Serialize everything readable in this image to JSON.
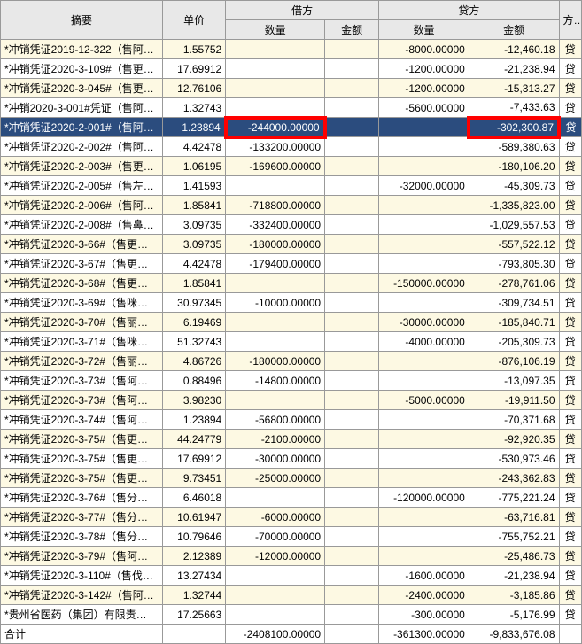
{
  "headers": {
    "summary": "摘要",
    "unitPrice": "单价",
    "debit": "借方",
    "credit": "贷方",
    "qty": "数量",
    "amount": "金额",
    "direction": "方向"
  },
  "footerLabel": "合计",
  "footer": {
    "dqty": "-2408100.00000",
    "damt": "",
    "cqty": "-361300.00000",
    "camt": "-9,833,676.08",
    "dir": ""
  },
  "rows": [
    {
      "summary": "*冲销凭证2019-12-322（售阿…",
      "price": "1.55752",
      "dqty": "",
      "damt": "",
      "cqty": "-8000.00000",
      "camt": "-12,460.18",
      "dir": "贷"
    },
    {
      "summary": "*冲销凭证2020-3-109#（售更…",
      "price": "17.69912",
      "dqty": "",
      "damt": "",
      "cqty": "-1200.00000",
      "camt": "-21,238.94",
      "dir": "贷"
    },
    {
      "summary": "*冲销凭证2020-3-045#（售更…",
      "price": "12.76106",
      "dqty": "",
      "damt": "",
      "cqty": "-1200.00000",
      "camt": "-15,313.27",
      "dir": "贷"
    },
    {
      "summary": "*冲销2020-3-001#凭证（售阿…",
      "price": "1.32743",
      "dqty": "",
      "damt": "",
      "cqty": "-5600.00000",
      "camt": "-7,433.63",
      "dir": "贷"
    },
    {
      "summary": "*冲销凭证2020-2-001#（售阿…",
      "price": "1.23894",
      "dqty": "-244000.00000",
      "damt": "",
      "cqty": "",
      "camt": "-302,300.87",
      "dir": "贷",
      "selected": true,
      "hl_dqty": true,
      "hl_camt": true
    },
    {
      "summary": "*冲销凭证2020-2-002#（售阿…",
      "price": "4.42478",
      "dqty": "-133200.00000",
      "damt": "",
      "cqty": "",
      "camt": "-589,380.63",
      "dir": "贷"
    },
    {
      "summary": "*冲销凭证2020-2-003#（售更…",
      "price": "1.06195",
      "dqty": "-169600.00000",
      "damt": "",
      "cqty": "",
      "camt": "-180,106.20",
      "dir": "贷"
    },
    {
      "summary": "*冲销凭证2020-2-005#（售左…",
      "price": "1.41593",
      "dqty": "",
      "damt": "",
      "cqty": "-32000.00000",
      "camt": "-45,309.73",
      "dir": "贷"
    },
    {
      "summary": "*冲销凭证2020-2-006#（售阿…",
      "price": "1.85841",
      "dqty": "-718800.00000",
      "damt": "",
      "cqty": "",
      "camt": "-1,335,823.00",
      "dir": "贷"
    },
    {
      "summary": "*冲销凭证2020-2-008#（售鼻…",
      "price": "3.09735",
      "dqty": "-332400.00000",
      "damt": "",
      "cqty": "",
      "camt": "-1,029,557.53",
      "dir": "贷"
    },
    {
      "summary": "*冲销凭证2020-3-66#（售更…",
      "price": "3.09735",
      "dqty": "-180000.00000",
      "damt": "",
      "cqty": "",
      "camt": "-557,522.12",
      "dir": "贷"
    },
    {
      "summary": "*冲销凭证2020-3-67#（售更…",
      "price": "4.42478",
      "dqty": "-179400.00000",
      "damt": "",
      "cqty": "",
      "camt": "-793,805.30",
      "dir": "贷"
    },
    {
      "summary": "*冲销凭证2020-3-68#（售更…",
      "price": "1.85841",
      "dqty": "",
      "damt": "",
      "cqty": "-150000.00000",
      "camt": "-278,761.06",
      "dir": "贷"
    },
    {
      "summary": "*冲销凭证2020-3-69#（售咪…",
      "price": "30.97345",
      "dqty": "-10000.00000",
      "damt": "",
      "cqty": "",
      "camt": "-309,734.51",
      "dir": "贷"
    },
    {
      "summary": "*冲销凭证2020-3-70#（售丽…",
      "price": "6.19469",
      "dqty": "",
      "damt": "",
      "cqty": "-30000.00000",
      "camt": "-185,840.71",
      "dir": "贷"
    },
    {
      "summary": "*冲销凭证2020-3-71#（售咪…",
      "price": "51.32743",
      "dqty": "",
      "damt": "",
      "cqty": "-4000.00000",
      "camt": "-205,309.73",
      "dir": "贷"
    },
    {
      "summary": "*冲销凭证2020-3-72#（售丽…",
      "price": "4.86726",
      "dqty": "-180000.00000",
      "damt": "",
      "cqty": "",
      "camt": "-876,106.19",
      "dir": "贷"
    },
    {
      "summary": "*冲销凭证2020-3-73#（售阿…",
      "price": "0.88496",
      "dqty": "-14800.00000",
      "damt": "",
      "cqty": "",
      "camt": "-13,097.35",
      "dir": "贷"
    },
    {
      "summary": "*冲销凭证2020-3-73#（售阿…",
      "price": "3.98230",
      "dqty": "",
      "damt": "",
      "cqty": "-5000.00000",
      "camt": "-19,911.50",
      "dir": "贷"
    },
    {
      "summary": "*冲销凭证2020-3-74#（售阿…",
      "price": "1.23894",
      "dqty": "-56800.00000",
      "damt": "",
      "cqty": "",
      "camt": "-70,371.68",
      "dir": "贷"
    },
    {
      "summary": "*冲销凭证2020-3-75#（售更…",
      "price": "44.24779",
      "dqty": "-2100.00000",
      "damt": "",
      "cqty": "",
      "camt": "-92,920.35",
      "dir": "贷"
    },
    {
      "summary": "*冲销凭证2020-3-75#（售更…",
      "price": "17.69912",
      "dqty": "-30000.00000",
      "damt": "",
      "cqty": "",
      "camt": "-530,973.46",
      "dir": "贷"
    },
    {
      "summary": "*冲销凭证2020-3-75#（售更…",
      "price": "9.73451",
      "dqty": "-25000.00000",
      "damt": "",
      "cqty": "",
      "camt": "-243,362.83",
      "dir": "贷"
    },
    {
      "summary": "*冲销凭证2020-3-76#（售分…",
      "price": "6.46018",
      "dqty": "",
      "damt": "",
      "cqty": "-120000.00000",
      "camt": "-775,221.24",
      "dir": "贷"
    },
    {
      "summary": "*冲销凭证2020-3-77#（售分…",
      "price": "10.61947",
      "dqty": "-6000.00000",
      "damt": "",
      "cqty": "",
      "camt": "-63,716.81",
      "dir": "贷"
    },
    {
      "summary": "*冲销凭证2020-3-78#（售分…",
      "price": "10.79646",
      "dqty": "-70000.00000",
      "damt": "",
      "cqty": "",
      "camt": "-755,752.21",
      "dir": "贷"
    },
    {
      "summary": "*冲销凭证2020-3-79#（售阿…",
      "price": "2.12389",
      "dqty": "-12000.00000",
      "damt": "",
      "cqty": "",
      "camt": "-25,486.73",
      "dir": "贷"
    },
    {
      "summary": "*冲销凭证2020-3-110#（售伐…",
      "price": "13.27434",
      "dqty": "",
      "damt": "",
      "cqty": "-1600.00000",
      "camt": "-21,238.94",
      "dir": "贷"
    },
    {
      "summary": "*冲销凭证2020-3-142#（售阿…",
      "price": "1.32744",
      "dqty": "",
      "damt": "",
      "cqty": "-2400.00000",
      "camt": "-3,185.86",
      "dir": "贷"
    },
    {
      "summary": "*贵州省医药（集团）有限责…",
      "price": "17.25663",
      "dqty": "",
      "damt": "",
      "cqty": "-300.00000",
      "camt": "-5,176.99",
      "dir": "贷"
    }
  ]
}
